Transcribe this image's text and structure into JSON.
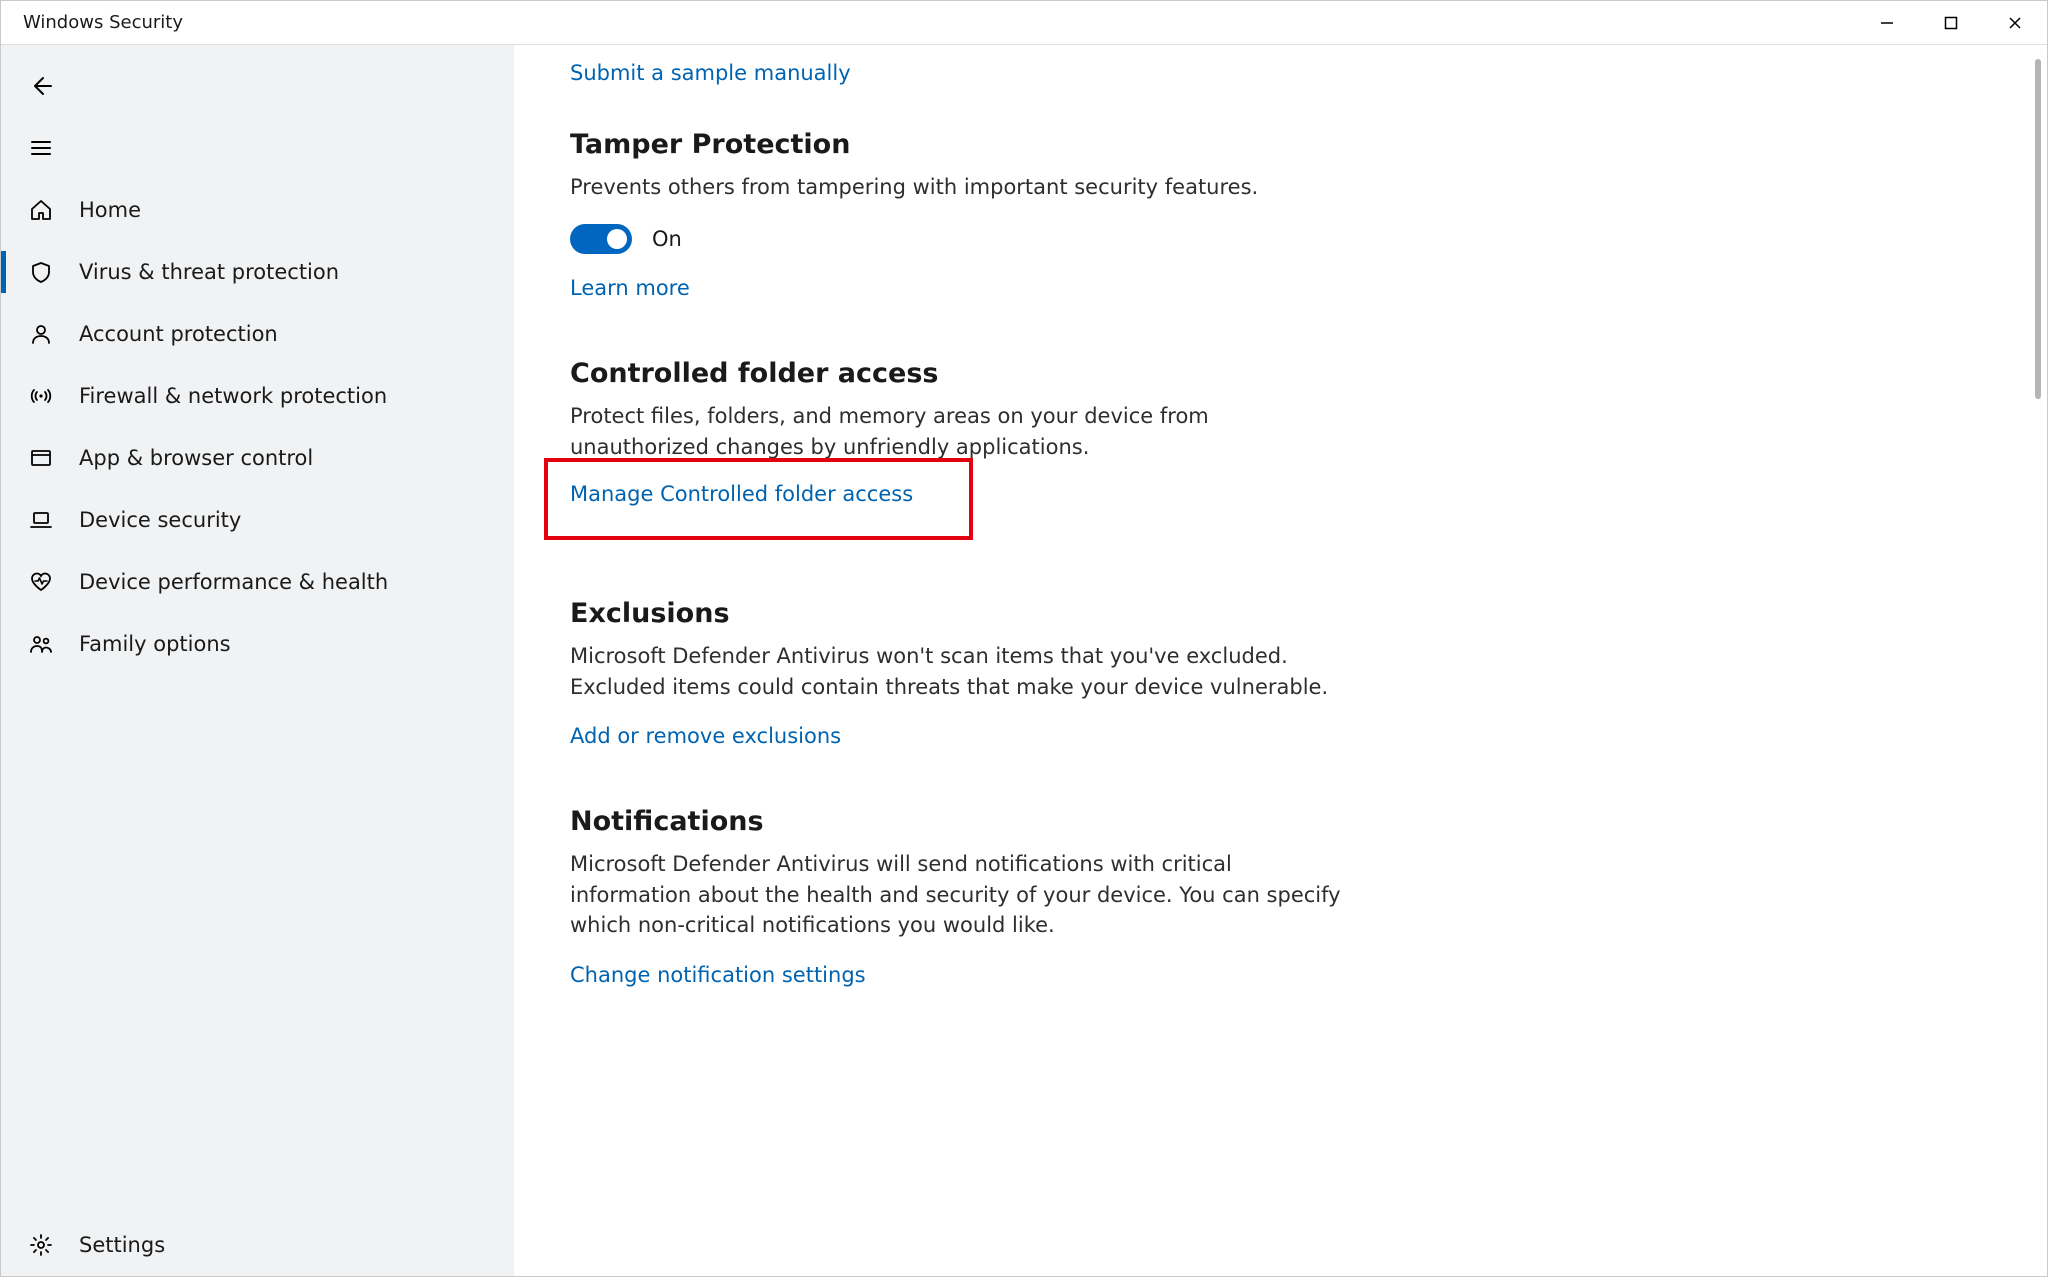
{
  "window": {
    "title": "Windows Security"
  },
  "sidebar": {
    "items": [
      {
        "icon": "home",
        "label": "Home"
      },
      {
        "icon": "shield",
        "label": "Virus & threat protection",
        "selected": true
      },
      {
        "icon": "person",
        "label": "Account protection"
      },
      {
        "icon": "antenna",
        "label": "Firewall & network protection"
      },
      {
        "icon": "monitor",
        "label": "App & browser control"
      },
      {
        "icon": "laptop",
        "label": "Device security"
      },
      {
        "icon": "heart",
        "label": "Device performance & health"
      },
      {
        "icon": "family",
        "label": "Family options"
      }
    ],
    "settings_label": "Settings"
  },
  "content": {
    "submit_sample_link": "Submit a sample manually",
    "tamper": {
      "heading": "Tamper Protection",
      "desc": "Prevents others from tampering with important security features.",
      "toggle_state": "On",
      "learn_more": "Learn more"
    },
    "cfa": {
      "heading": "Controlled folder access",
      "desc": "Protect files, folders, and memory areas on your device from unauthorized changes by unfriendly applications.",
      "manage_link": "Manage Controlled folder access"
    },
    "exclusions": {
      "heading": "Exclusions",
      "desc": "Microsoft Defender Antivirus won't scan items that you've excluded. Excluded items could contain threats that make your device vulnerable.",
      "link": "Add or remove exclusions"
    },
    "notifications": {
      "heading": "Notifications",
      "desc": "Microsoft Defender Antivirus will send notifications with critical information about the health and security of your device. You can specify which non-critical notifications you would like.",
      "link": "Change notification settings"
    }
  }
}
